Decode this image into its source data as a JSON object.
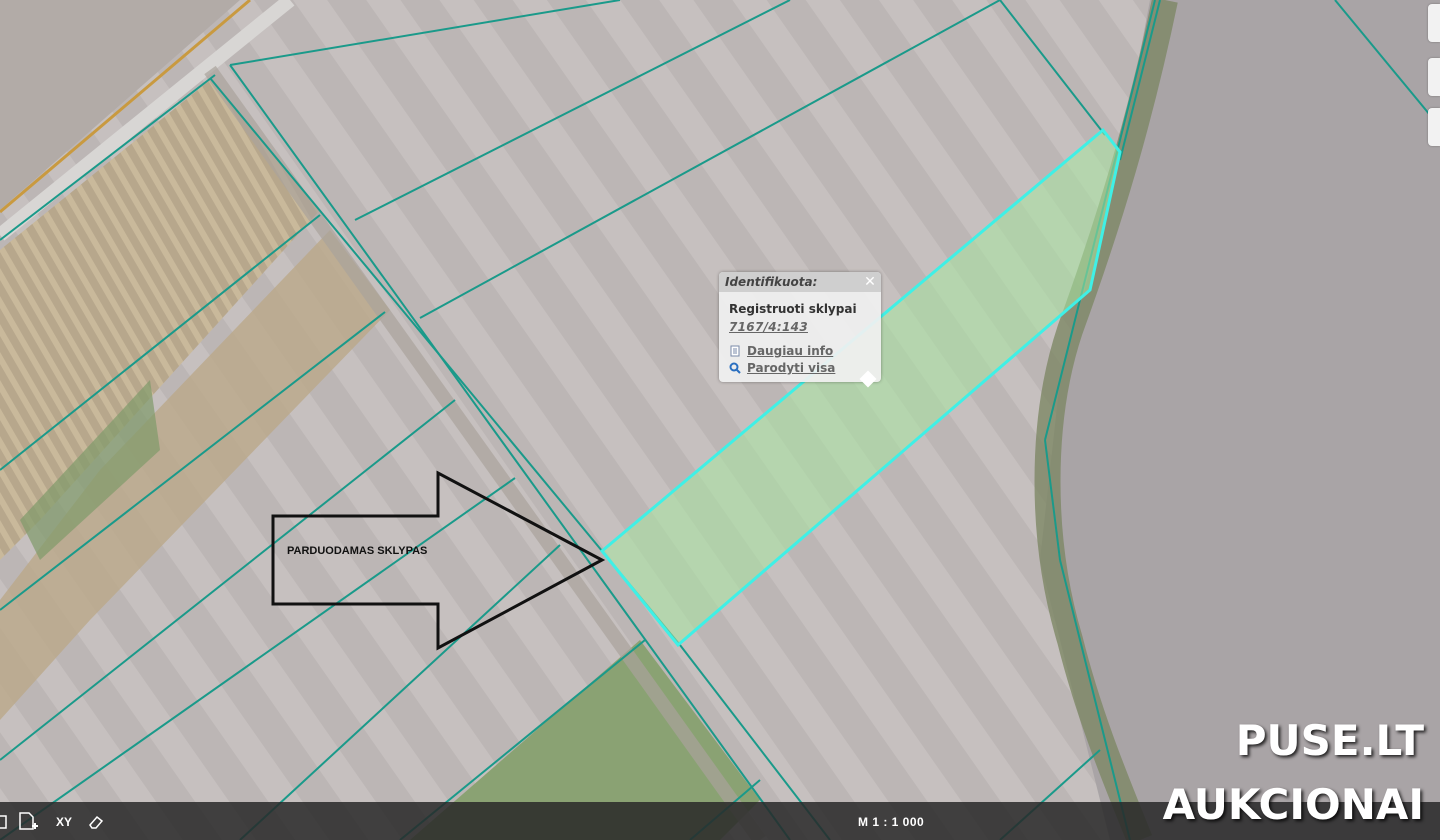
{
  "map": {
    "colors": {
      "parcel_line": "#1a9a8a",
      "highlight": "#3ff0e6",
      "highlight_fill": "#a8e6a0"
    }
  },
  "popup": {
    "header": "Identifikuota:",
    "close_icon": "close-icon",
    "layer": "Registruoti sklypai",
    "parcel_id": "7167/4:143",
    "more_info": "Daugiau info",
    "show_all": "Parodyti visa"
  },
  "annotation": {
    "arrow_text": "PARDUODAMAS SKLYPAS"
  },
  "statusbar": {
    "xy_label": "XY",
    "scale": "M 1 : 1 000",
    "icons": [
      "polygon-icon",
      "new-file-icon",
      "xy-icon",
      "eraser-icon"
    ]
  },
  "watermark": {
    "line1": "PUSE.LT",
    "line2": "AUKCIONAI"
  }
}
